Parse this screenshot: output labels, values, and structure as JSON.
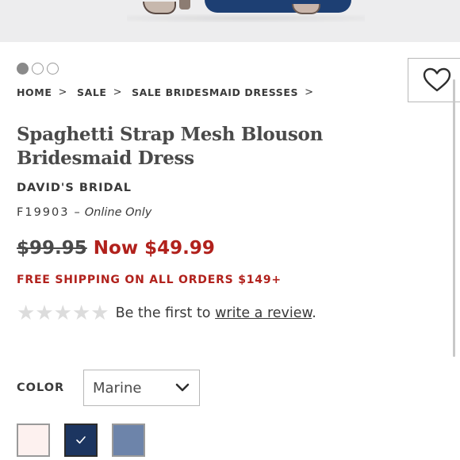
{
  "breadcrumb": [
    {
      "label": "HOME",
      "sep": ">"
    },
    {
      "label": "SALE",
      "sep": ">"
    },
    {
      "label": "SALE BRIDESMAID DRESSES",
      "sep": ">"
    }
  ],
  "carousel": {
    "count": 3,
    "active_index": 0
  },
  "product": {
    "title": "Spaghetti Strap Mesh Blouson Bridesmaid Dress",
    "brand": "DAVID'S BRIDAL",
    "sku": "F19903",
    "sku_separator": "–",
    "availability": "Online Only",
    "original_price": "$99.95",
    "sale_price": "Now $49.99",
    "shipping_notice": "FREE SHIPPING ON ALL ORDERS $149+"
  },
  "review": {
    "rating": 0,
    "max_rating": 5,
    "prefix_text": "Be the first to",
    "link_text": "write a review",
    "suffix_text": "."
  },
  "color": {
    "label": "COLOR",
    "selected": "Marine",
    "swatches": [
      {
        "name": "blush",
        "hex": "#fdf1ef",
        "selected": false
      },
      {
        "name": "marine",
        "hex": "#1c3560",
        "selected": true
      },
      {
        "name": "blue-steel",
        "hex": "#6d84aa",
        "selected": false
      }
    ]
  },
  "icons": {
    "wishlist": "heart-icon",
    "dropdown": "chevron-down-icon",
    "swatch_check": "check-icon",
    "rating": "star-icon"
  },
  "colors": {
    "accent_red": "#b1211c",
    "text": "#3a3a3a",
    "star_empty": "#dcdcdc"
  }
}
